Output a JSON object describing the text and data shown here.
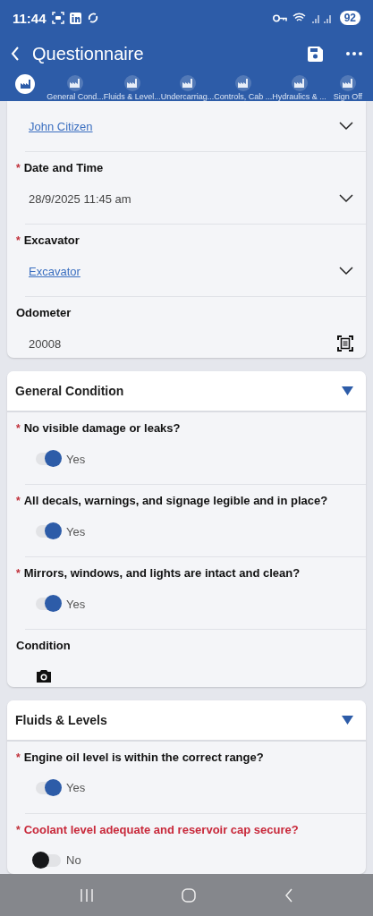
{
  "status_bar": {
    "time": "11:44",
    "battery": "92"
  },
  "header": {
    "title": "Questionnaire"
  },
  "tabs": [
    {
      "selected": true
    },
    {
      "label": "General Cond...",
      "selected": false
    },
    {
      "label": "Fluids & Level...",
      "selected": false
    },
    {
      "label": "Undercarriag...",
      "selected": false
    },
    {
      "label": "Controls, Cab ...",
      "selected": false
    },
    {
      "label": "Hydraulics & ...",
      "selected": false
    },
    {
      "label": "Sign Off",
      "selected": false
    }
  ],
  "details": [
    {
      "kind": "select",
      "value": "John Citizen",
      "link": true
    },
    {
      "kind": "select",
      "marker": "*",
      "label": "Date and Time",
      "value": "28/9/2025 11:45 am",
      "link": false
    },
    {
      "kind": "select",
      "marker": "*",
      "label": "Excavator",
      "value": "Excavator",
      "link": true
    },
    {
      "kind": "scan",
      "label": "Odometer",
      "value": "20008",
      "link": false
    }
  ],
  "sections": [
    {
      "title": "General Condition",
      "expanded": true,
      "questions": [
        {
          "kind": "toggle",
          "marker": "*",
          "error": false,
          "label": "No visible damage or leaks?",
          "on": true,
          "answer": "Yes"
        },
        {
          "kind": "toggle",
          "marker": "*",
          "error": false,
          "label": "All decals, warnings, and signage legible and in place?",
          "on": true,
          "answer": "Yes"
        },
        {
          "kind": "toggle",
          "marker": "*",
          "error": false,
          "label": "Mirrors, windows, and lights are intact and clean?",
          "on": true,
          "answer": "Yes"
        },
        {
          "kind": "photo",
          "error": false,
          "label": "Condition"
        }
      ]
    },
    {
      "title": "Fluids & Levels",
      "expanded": true,
      "questions": [
        {
          "kind": "toggle",
          "marker": "*",
          "error": false,
          "label": "Engine oil level is within the correct range?",
          "on": true,
          "answer": "Yes"
        },
        {
          "kind": "toggle",
          "marker": "*",
          "error": true,
          "label": "Coolant level adequate and reservoir cap secure?",
          "on": false,
          "answer": "No"
        }
      ]
    }
  ]
}
